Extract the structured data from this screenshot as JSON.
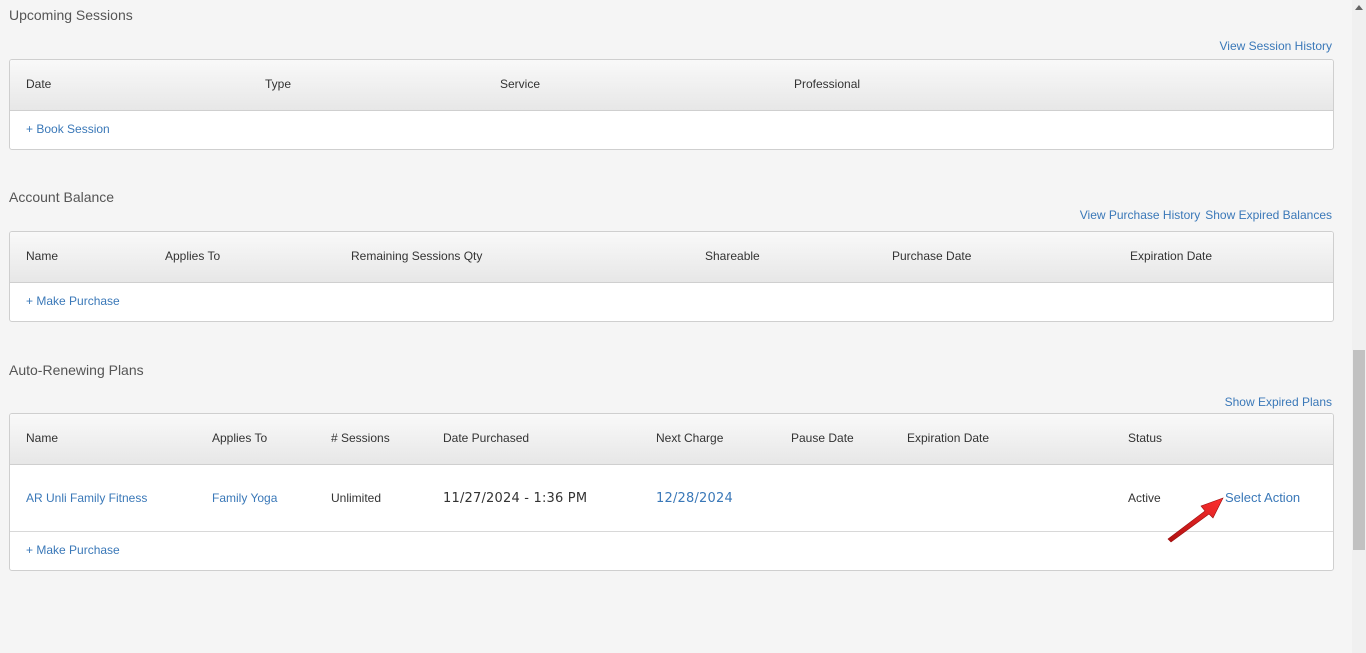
{
  "upcoming": {
    "title": "Upcoming Sessions",
    "history_link": "View Session History",
    "headers": [
      "Date",
      "Type",
      "Service",
      "Professional"
    ],
    "book_link": "+ Book Session"
  },
  "balance": {
    "title": "Account Balance",
    "purchase_history_link": "View Purchase History",
    "expired_balances_link": "Show Expired Balances",
    "headers": [
      "Name",
      "Applies To",
      "Remaining Sessions Qty",
      "Shareable",
      "Purchase Date",
      "Expiration Date"
    ],
    "make_purchase_link": "+ Make Purchase"
  },
  "plans": {
    "title": "Auto-Renewing Plans",
    "expired_plans_link": "Show Expired Plans",
    "headers": [
      "Name",
      "Applies To",
      "# Sessions",
      "Date Purchased",
      "Next Charge",
      "Pause Date",
      "Expiration Date",
      "Status"
    ],
    "rows": [
      {
        "name": "AR Unli Family Fitness",
        "applies_to": "Family Yoga",
        "sessions": "Unlimited",
        "date_purchased": "11/27/2024 - 1:36 PM",
        "next_charge": "12/28/2024",
        "pause_date": "",
        "expiration_date": "",
        "status": "Active",
        "action": "Select Action"
      }
    ],
    "make_purchase_link": "+ Make Purchase"
  },
  "colors": {
    "link": "#3a78b8",
    "arrow": "#e02020"
  }
}
